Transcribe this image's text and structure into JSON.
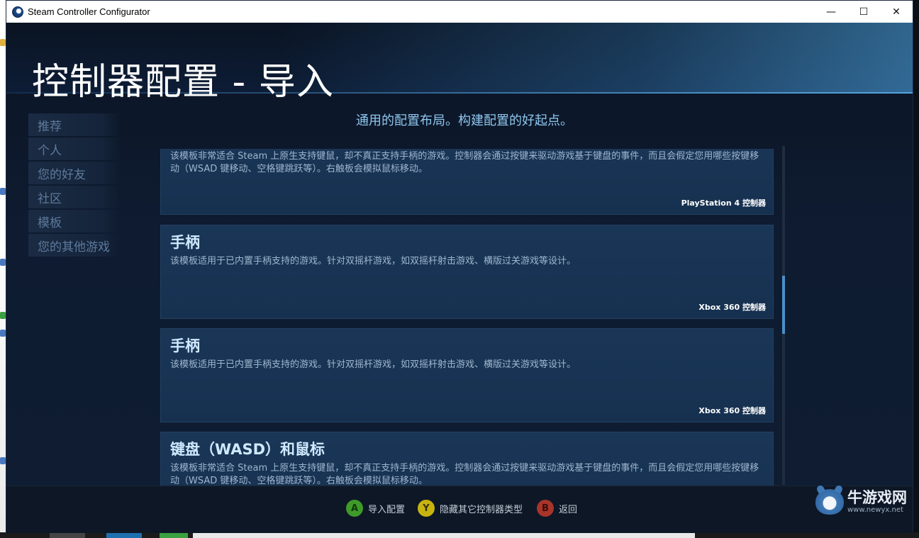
{
  "window": {
    "title": "Steam Controller Configurator",
    "controls": {
      "minimize": "—",
      "maximize": "☐",
      "close": "✕"
    }
  },
  "page": {
    "title": "控制器配置 - 导入",
    "subtitle": "通用的配置布局。构建配置的好起点。"
  },
  "sidebar": {
    "items": [
      {
        "label": "推荐"
      },
      {
        "label": "个人"
      },
      {
        "label": "您的好友"
      },
      {
        "label": "社区"
      },
      {
        "label": "模板"
      },
      {
        "label": "您的其他游戏"
      }
    ]
  },
  "templates": [
    {
      "title": "",
      "description": "该模板非常适合 Steam 上原生支持键鼠，却不真正支持手柄的游戏。控制器会通过按键来驱动游戏基于键盘的事件，而且会假定您用哪些按键移动（WSAD 键移动、空格键跳跃等）。右触板会模拟鼠标移动。",
      "controller": "PlayStation 4 控制器"
    },
    {
      "title": "手柄",
      "description": "该模板适用于已内置手柄支持的游戏。针对双摇杆游戏，如双摇杆射击游戏、横版过关游戏等设计。",
      "controller": "Xbox 360 控制器"
    },
    {
      "title": "手柄",
      "description": "该模板适用于已内置手柄支持的游戏。针对双摇杆游戏，如双摇杆射击游戏、横版过关游戏等设计。",
      "controller": "Xbox 360 控制器"
    },
    {
      "title": "键盘（WASD）和鼠标",
      "description": "该模板非常适合 Steam 上原生支持键鼠，却不真正支持手柄的游戏。控制器会通过按键来驱动游戏基于键盘的事件，而且会假定您用哪些按键移动（WSAD 键移动、空格键跳跃等）。右触板会模拟鼠标移动。",
      "controller": ""
    }
  ],
  "footer": {
    "hints": [
      {
        "glyph": "A",
        "label": "导入配置",
        "color": "#3f9a2a",
        "glyph_color": "#0e3a08"
      },
      {
        "glyph": "Y",
        "label": "隐藏其它控制器类型",
        "color": "#c8b410",
        "glyph_color": "#3a3300"
      },
      {
        "glyph": "B",
        "label": "返回",
        "color": "#a8342a",
        "glyph_color": "#3a0c08"
      }
    ]
  },
  "watermark": {
    "name": "牛游戏网",
    "url": "www.newyx.net"
  },
  "colors": {
    "accent": "#8fc7ef",
    "card_bg": "#1a3656",
    "sidebar_text": "#5d7a9c",
    "scroll_thumb": "#4a90c8"
  }
}
